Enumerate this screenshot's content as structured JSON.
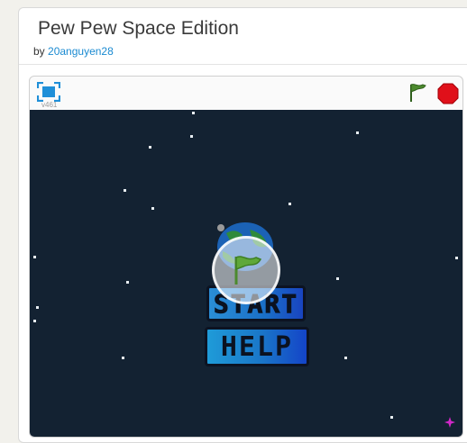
{
  "project": {
    "title": "Pew Pew Space Edition",
    "by_prefix": "by",
    "author": "20anguyen28"
  },
  "player": {
    "version": "v461",
    "fullscreen_icon": "fullscreen-icon",
    "green_flag_icon": "green-flag-icon",
    "stop_icon": "stop-sign-icon"
  },
  "stage": {
    "start_label": "START",
    "help_label": "HELP"
  },
  "colors": {
    "stage_bg": "#132232",
    "flag_green": "#4c8a2e",
    "stop_red": "#e0101a",
    "link_blue": "#1a8ad1"
  }
}
